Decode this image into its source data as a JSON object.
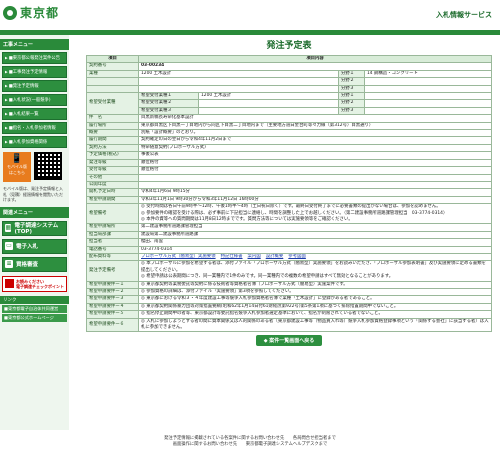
{
  "header": {
    "logo_text": "東京都",
    "service_title": "入札情報サービス"
  },
  "sidebar": {
    "menu_title": "工事メニュー",
    "items": [
      {
        "label": "■東京都公報発注案件公告"
      },
      {
        "label": "■工事発注予定情報"
      },
      {
        "label": "■発注予定情報"
      },
      {
        "label": "■入札状況(一般競争)"
      },
      {
        "label": "■入札結果一覧"
      },
      {
        "label": "■指名・入札参加者情報"
      },
      {
        "label": "■入札参加資格関係"
      }
    ],
    "mobile_badge": "モバイル版\nはこちら",
    "mobile_note": "モバイル版は、発注予定情報と入札（見積）経過情報を閲覧いただけます。",
    "nav2_title": "関連メニュー",
    "bignav": [
      {
        "label": "電子調達システム(TOP)",
        "icon": "building-icon"
      },
      {
        "label": "電子入札",
        "icon": "pc-icon"
      },
      {
        "label": "資格審査",
        "icon": "document-icon"
      }
    ],
    "adobe_text": "お読みください\n電子調達チェックポイント",
    "links_title": "リンク",
    "links": [
      {
        "label": "■東京都電子自治体共同運営"
      },
      {
        "label": "■東京都公式ホームページ"
      }
    ]
  },
  "main": {
    "title": "発注予定表",
    "col_item": "項目",
    "col_content": "項目内容",
    "rows": [
      {
        "label": "契約番号",
        "value": "03-00234"
      },
      {
        "label": "業種",
        "value": "1200 土木設計",
        "extra_label": "分野１",
        "extra_value": "14 鋼構造・コンクリート"
      },
      {
        "label": "",
        "value": "",
        "extra_label": "分野２",
        "extra_value": ""
      },
      {
        "label": "",
        "value": "",
        "extra_label": "分野３",
        "extra_value": ""
      }
    ],
    "hope": {
      "label": "希望受付業種",
      "subs": [
        {
          "k": "希望受付業種１",
          "v": "1200 土木設計"
        },
        {
          "k": "希望受付業種２",
          "v": ""
        },
        {
          "k": "希望受付業種３",
          "v": ""
        }
      ],
      "fields": [
        {
          "k": "分野１",
          "v": ""
        },
        {
          "k": "分野２",
          "v": ""
        },
        {
          "k": "分野３",
          "v": ""
        }
      ]
    },
    "simple": [
      {
        "label": "件　名",
        "value": "目黒新橋長寿命化基本設計"
      },
      {
        "label": "履行場所",
        "value": "東京都目黒区下目黒一丁目地内から同区下目黒二丁目地内まで（主要地方道白金台町等々力線（第312号）目黒通り）"
      },
      {
        "label": "概要",
        "value": "別紙「設計概要」のとおり。"
      },
      {
        "label": "履行期間",
        "value": "契約確定の日の翌日から令和4年11月2日まで"
      },
      {
        "label": "契約方法",
        "value": "特命随意契約(プロポーザル方式)"
      },
      {
        "label": "予定価格(税込)",
        "value": "事後公表"
      },
      {
        "label": "発注等級",
        "value": "順位格付"
      },
      {
        "label": "受付等級",
        "value": "順位格付"
      },
      {
        "label": "その他",
        "value": ""
      },
      {
        "label": "公開年度",
        "value": ""
      },
      {
        "label": "開札予定日時",
        "value": "令和4年1月6日 9時15分"
      },
      {
        "label": "希望申請期間",
        "value": "令和3年11月1日 9時30分から令和3年11月12日 16時00分"
      }
    ],
    "notes": {
      "label": "希望備考",
      "lines": [
        "◎ 受付時間は各日午前9時半〜12時、午後1時半〜4時（土日祝日除く）です。最終日受付終了までに必要書類の提出がない場合は、参加を認めません。",
        "◎ 参加要件の確認を受ける際は、必ず事前に下記担当に連絡し、時間を調整した上でお越しください。（第二建設事務所道路課管理担当　03-3774-0314）",
        "◎ 本件の資等への質問期間は11月8日12時までです。質問方法等については実施要領等をご確認ください。"
      ]
    },
    "simple2": [
      {
        "label": "希望申請場所",
        "value": "第二建設事務所道路課管理担当"
      },
      {
        "label": "担当局部課",
        "value": "建設局第二建設事務所道路課"
      },
      {
        "label": "担当者",
        "value": "櫻田、南雲"
      },
      {
        "label": "電話番号",
        "value": "03-3774-0314"
      }
    ],
    "docs": {
      "label": "配布資料等",
      "items": [
        "プロポーザル方式（簡易型）実施要領",
        "特記仕様書",
        "案内図",
        "設計概要",
        "参考図面"
      ]
    },
    "condition": {
      "label": "発注予定備考",
      "lines": [
        "◎ 本プロポーザルに参加を希望する者は、添付ファイル「プロポーザル方式（簡易型）実施要領」をお読みいただき、「プロポーザル参加表明書」及び実施要領に定める書類を提出してください。",
        "◎ 希望申請は公表期間につき、同一業種内で1件のみです。同一業種内での複数の希望申請はすべて無効となることがあります。"
      ]
    },
    "conds": [
      {
        "label": "希望申請要件ー１",
        "value": "◎ 東京都契約等業務委託等契約に係る技術者等資格者名簿（プロポーザル方式（簡易型）実施案件です。"
      },
      {
        "label": "希望申請要件ー２",
        "value": "◎ 参加資格の詳細は、添付ファイル「実施要領」第3項を参照してください。"
      },
      {
        "label": "希望申請要件ー３",
        "value": "◎ 東京都における令和３・４年度建設工事等競争入札参加資格者名簿で業種「土木設計」に登録がある者であること。"
      },
      {
        "label": "希望申請要件ー４",
        "value": "◎ 東京都契約関係暴力団等対策措置要綱(昭和62年1月14日付61財経庶第922号)第5条第1項に基づく排除措置期間中でないこと。"
      },
      {
        "label": "希望申請要件ー５",
        "value": "◎ 指名停止期間中の者等、東京都設計等委託指名競争入札参加者選定基準において、指名が制限されている者でないこと。"
      },
      {
        "label": "希望申請要件ー６",
        "value": "◎ 入札に参加しようとする者の間に資本関係又は人的関係のある者（東京都建設工事等（物品買入れ等）競争入札参加資格登録事項という「関係する会社」に該当する者）は入札に参加できません。"
      }
    ],
    "back_button": "案件一覧画面へ戻る"
  },
  "footer": {
    "line1": "発注予定情報に掲載されている各案件に関するお問い合わせ先　　各局問合せ担当者まで",
    "line2": "画面操作に関するお問い合わせ先　　東京都電子調達システムヘルプデスクまで"
  }
}
